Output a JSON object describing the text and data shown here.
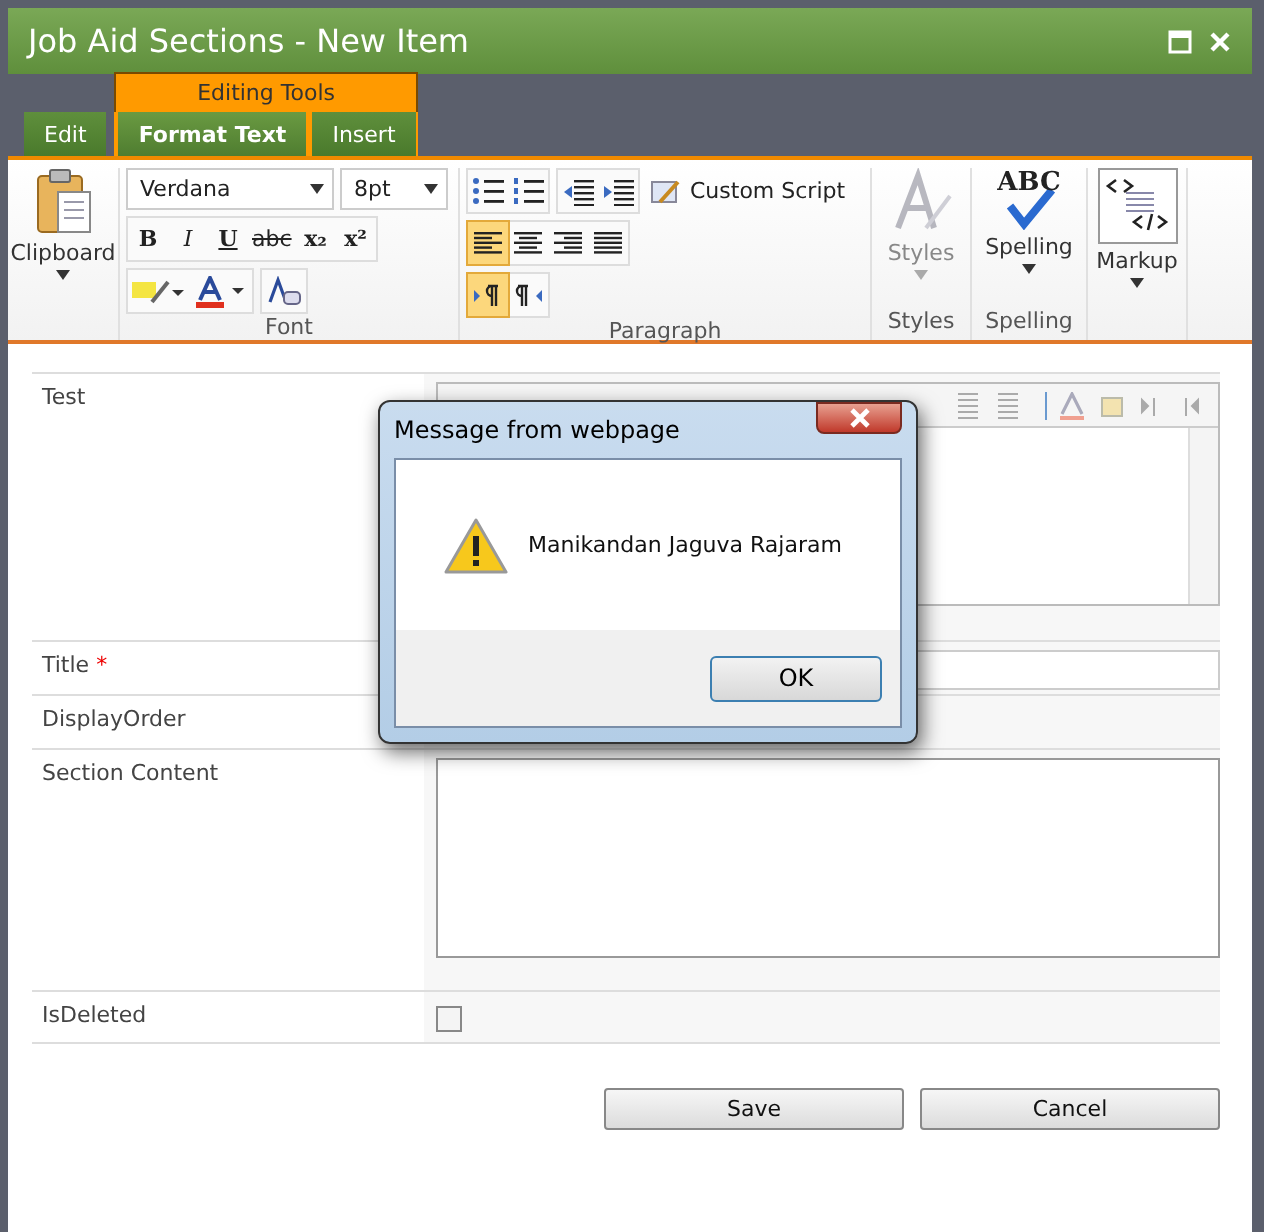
{
  "window": {
    "title": "Job Aid Sections - New Item"
  },
  "ribbon_tabs": {
    "tabs": [
      {
        "label": "Edit",
        "selected": false
      }
    ],
    "contextual_group": {
      "label": "Editing Tools",
      "tabs": [
        {
          "label": "Format Text",
          "selected": true
        },
        {
          "label": "Insert",
          "selected": false
        }
      ]
    }
  },
  "ribbon": {
    "clipboard": {
      "label": "Clipboard"
    },
    "font": {
      "font_name": "Verdana",
      "font_size": "8pt",
      "format_buttons": [
        "B",
        "I",
        "U",
        "abc",
        "x₂",
        "x²"
      ],
      "label": "Font"
    },
    "paragraph": {
      "custom_script": "Custom Script",
      "alignments": [
        {
          "selected": true
        },
        {
          "selected": false
        },
        {
          "selected": false
        },
        {
          "selected": false
        }
      ],
      "directions": [
        {
          "selected": true
        },
        {
          "selected": false
        }
      ],
      "label": "Paragraph"
    },
    "styles": {
      "button": "Styles",
      "label": "Styles",
      "disabled": true
    },
    "spelling": {
      "icon_text": "ABC",
      "button": "Spelling",
      "label": "Spelling"
    },
    "markup": {
      "button": "Markup"
    }
  },
  "fields": [
    {
      "label": "Test",
      "kind": "richtext"
    },
    {
      "label": "Title",
      "kind": "text",
      "required_mark": "*"
    },
    {
      "label": "DisplayOrder",
      "kind": "hidden"
    },
    {
      "label": "Section Content",
      "kind": "textarea"
    },
    {
      "label": "IsDeleted",
      "kind": "checkbox",
      "checked": false
    }
  ],
  "buttons": [
    "Save",
    "Cancel"
  ],
  "dialog": {
    "title": "Message from webpage",
    "message": "Manikandan Jaguva Rajaram",
    "button": "OK"
  }
}
